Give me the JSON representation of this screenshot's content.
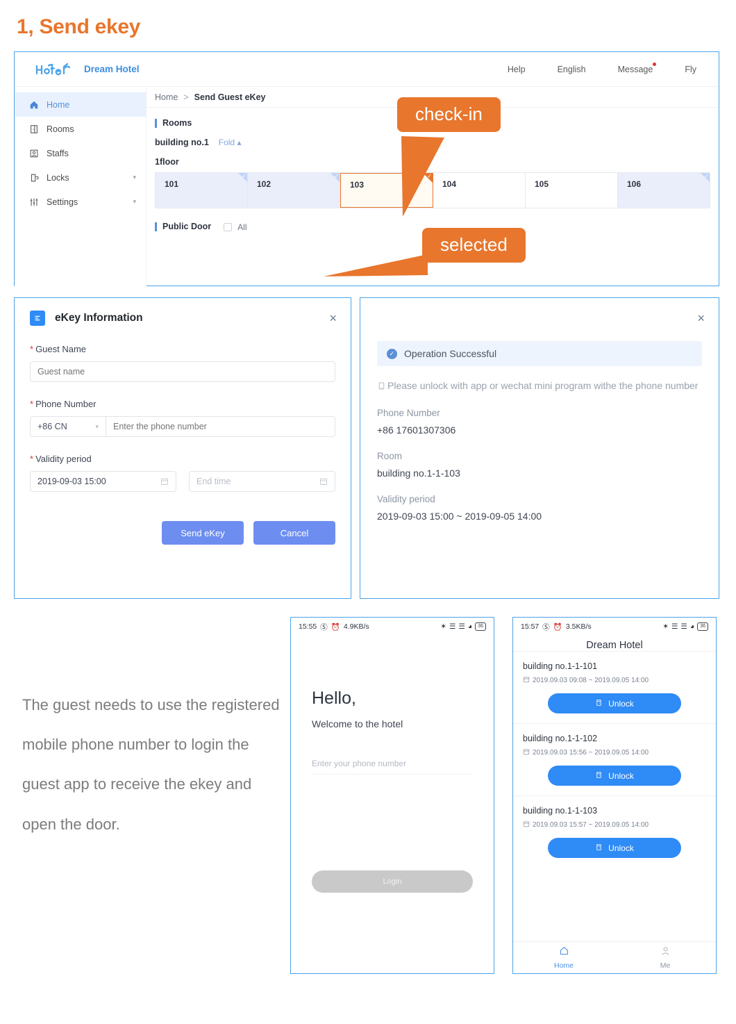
{
  "page": {
    "title": "1, Send ekey"
  },
  "browser": {
    "brand": {
      "logo_text": "Hotel",
      "name": "Dream Hotel"
    },
    "top_nav": [
      {
        "label": "Help",
        "dot": false
      },
      {
        "label": "English",
        "dot": false
      },
      {
        "label": "Message",
        "dot": true
      },
      {
        "label": "Fly",
        "dot": false
      }
    ],
    "sidebar": [
      {
        "label": "Home",
        "icon": "home-icon",
        "active": true,
        "caret": false
      },
      {
        "label": "Rooms",
        "icon": "door-icon",
        "active": false,
        "caret": false
      },
      {
        "label": "Staffs",
        "icon": "user-id-icon",
        "active": false,
        "caret": false
      },
      {
        "label": "Locks",
        "icon": "lock-icon",
        "active": false,
        "caret": true
      },
      {
        "label": "Settings",
        "icon": "sliders-icon",
        "active": false,
        "caret": true
      }
    ],
    "breadcrumb": {
      "first": "Home",
      "separator": ">",
      "current": "Send Guest eKey"
    },
    "rooms_section": {
      "title": "Rooms",
      "building": "building no.1",
      "fold": "Fold",
      "floor": "1floor",
      "rooms": [
        {
          "number": "101",
          "state": "occupied"
        },
        {
          "number": "102",
          "state": "occupied"
        },
        {
          "number": "103",
          "state": "selected"
        },
        {
          "number": "104",
          "state": "free"
        },
        {
          "number": "105",
          "state": "free"
        },
        {
          "number": "106",
          "state": "occupied"
        }
      ]
    },
    "public_door": {
      "title": "Public Door",
      "all_label": "All",
      "checked": false
    }
  },
  "callouts": {
    "check_in": "check-in",
    "selected": "selected"
  },
  "dialog": {
    "title": "eKey Information",
    "close": "×",
    "guest_name": {
      "label": "Guest Name",
      "required": "*",
      "placeholder": "Guest name",
      "value": ""
    },
    "phone": {
      "label": "Phone Number",
      "required": "*",
      "country_code": "+86 CN",
      "placeholder": "Enter the phone number",
      "value": ""
    },
    "validity": {
      "label": "Validity period",
      "required": "*",
      "start_value": "2019-09-03 15:00",
      "end_placeholder": "End time"
    },
    "send_button": "Send eKey",
    "cancel_button": "Cancel"
  },
  "success": {
    "close": "×",
    "banner": "Operation Successful",
    "note": "Please unlock with app or wechat mini program withe the phone number",
    "phone_label": "Phone Number",
    "phone_value": "+86 17601307306",
    "room_label": "Room",
    "room_value": "building no.1-1-103",
    "validity_label": "Validity period",
    "validity_value": "2019-09-03 15:00  ~  2019-09-05 14:00"
  },
  "paragraph": "The guest needs to use the registered mobile phone number to login the guest app to receive the ekey and open the door.",
  "phone1": {
    "status": {
      "time": "15:55",
      "speed": "4.9KB/s",
      "battery": "36"
    },
    "hello": "Hello,",
    "welcome": "Welcome to the hotel",
    "input_placeholder": "Enter your phone number",
    "login_button": "Login"
  },
  "phone2": {
    "status": {
      "time": "15:57",
      "speed": "3.5KB/s",
      "battery": "36"
    },
    "title": "Dream Hotel",
    "items": [
      {
        "room": "building no.1-1-101",
        "time": "2019.09.03 09:08 ~ 2019.09.05 14:00",
        "button": "Unlock"
      },
      {
        "room": "building no.1-1-102",
        "time": "2019.09.03 15:56 ~ 2019.09.05 14:00",
        "button": "Unlock"
      },
      {
        "room": "building no.1-1-103",
        "time": "2019.09.03 15:57 ~ 2019.09.05 14:00",
        "button": "Unlock"
      }
    ],
    "tabs": [
      {
        "label": "Home",
        "icon": "home-icon",
        "active": true
      },
      {
        "label": "Me",
        "icon": "person-icon",
        "active": false
      }
    ]
  },
  "colors": {
    "accent_orange": "#e8762c",
    "brand_blue": "#3c8dde",
    "button_blue": "#6d8ef0",
    "unlock_blue": "#2f8bf5",
    "panel_border": "#4da3e8"
  }
}
